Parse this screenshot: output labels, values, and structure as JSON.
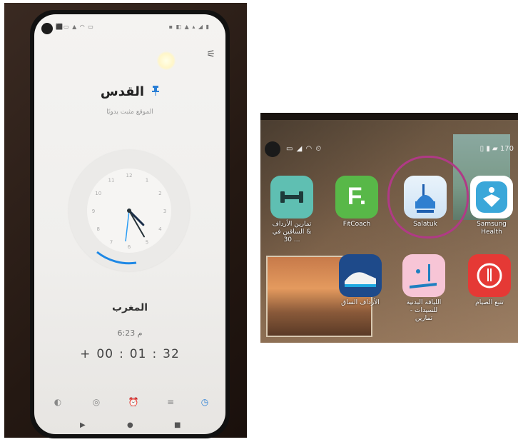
{
  "left_screen": {
    "status_left": "⬛▭ ▲ ◠ ▭",
    "status_right": "▪ ◧ ▲ ▴ ◢ ▮",
    "menu_icon": "⚟",
    "city": "القدس",
    "pin_icon": "pin-icon",
    "subtitle": "الموقع مثبت يدويًا",
    "clock": {
      "numbers": [
        "12",
        "1",
        "2",
        "3",
        "4",
        "5",
        "6",
        "7",
        "8",
        "9",
        "10",
        "11"
      ],
      "hour_hand_hour": 4.5,
      "minute_hand_minute": 25
    },
    "prayer_name": "المغرب",
    "prayer_time": "6:23 م",
    "countdown": {
      "prefix": "+",
      "hours": "00",
      "minutes": "01",
      "seconds": "32",
      "sep": ":"
    },
    "bottom_nav": [
      {
        "icon": "compass-icon",
        "glyph": "◐",
        "active": false
      },
      {
        "icon": "mosque-icon",
        "glyph": "◎",
        "active": false
      },
      {
        "icon": "alarm-icon",
        "glyph": "⏰",
        "active": false
      },
      {
        "icon": "list-icon",
        "glyph": "≡",
        "active": false
      },
      {
        "icon": "clock-icon",
        "glyph": "◷",
        "active": true
      }
    ],
    "sys_nav": [
      "▶",
      "●",
      "■"
    ]
  },
  "right_screen": {
    "status_left": "▭ ◢ ◠ ⏲",
    "status_right": "▯ ▮ ▰ 170",
    "apps_row1": [
      {
        "name": "dumbbell-app",
        "label": "تمارين الأرداف & الساقين في 30 ...",
        "color": "#5fbfb2"
      },
      {
        "name": "fitcoach-app",
        "label": "FitCoach",
        "color": "#58b848",
        "glyph": "F."
      },
      {
        "name": "salatuk-app",
        "label": "Salatuk",
        "color": "#3b8fd8"
      },
      {
        "name": "samsung-health-app",
        "label": "Samsung Health",
        "color": "#3aa7d9"
      }
    ],
    "apps_row2": [
      {
        "name": "shoe-app",
        "label": "الأرداف الساق",
        "color": "#1e4a8a"
      },
      {
        "name": "treadmill-app",
        "label": "اللياقة البدنية للسيدات - تمارين",
        "color": "#f7c5d6"
      },
      {
        "name": "fasting-app",
        "label": "تتبع الصيام",
        "color": "#e53935"
      }
    ]
  }
}
